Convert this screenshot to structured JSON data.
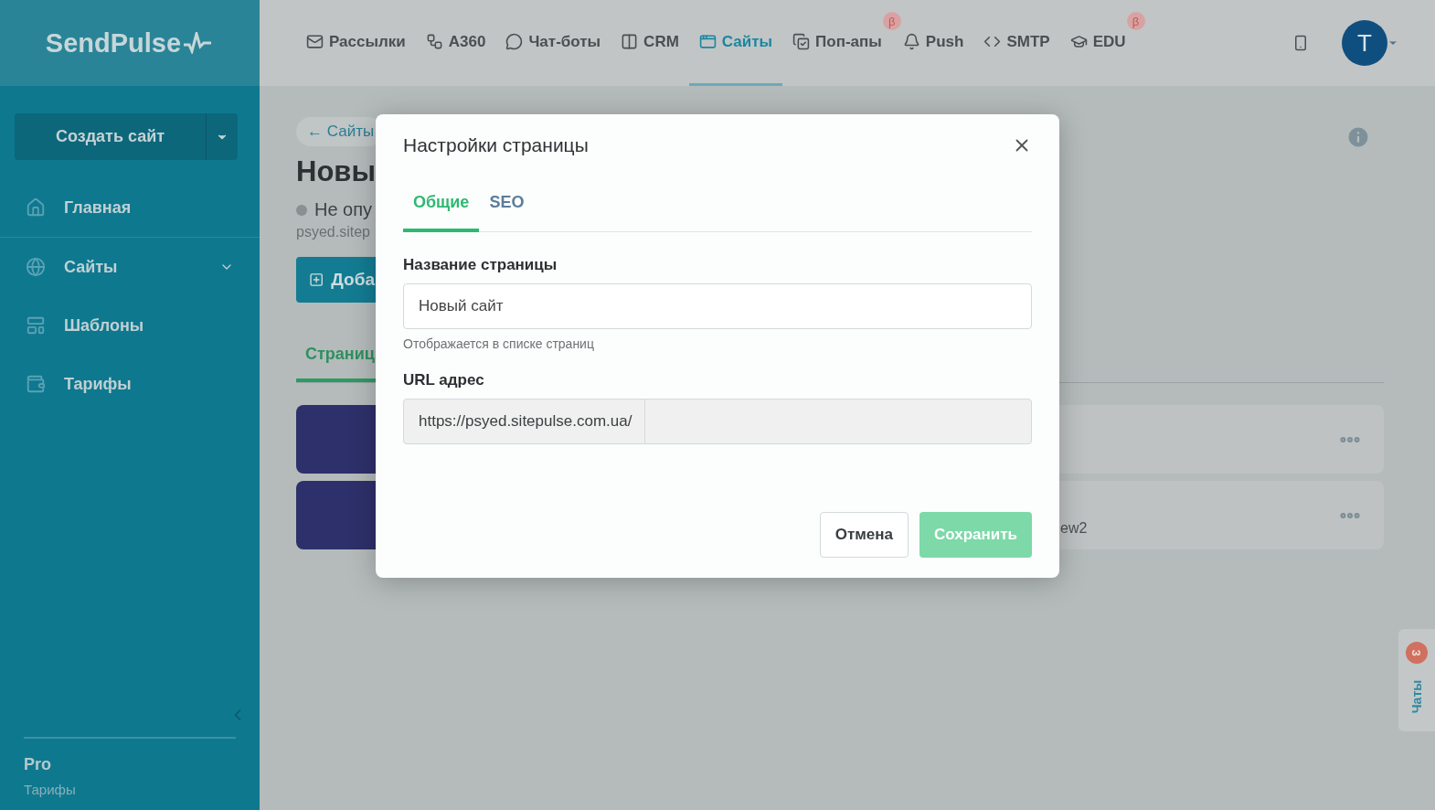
{
  "sidebar": {
    "logo": "SendPulse",
    "create_button": "Создать сайт",
    "items": [
      {
        "label": "Главная",
        "expandable": false
      },
      {
        "label": "Сайты",
        "expandable": true
      },
      {
        "label": "Шаблоны",
        "expandable": false
      },
      {
        "label": "Тарифы",
        "expandable": false
      }
    ],
    "plan": {
      "name": "Pro",
      "link": "Тарифы"
    }
  },
  "topnav": {
    "items": [
      {
        "label": "Рассылки",
        "selected": false
      },
      {
        "label": "A360",
        "selected": false
      },
      {
        "label": "Чат-боты",
        "selected": false
      },
      {
        "label": "CRM",
        "selected": false
      },
      {
        "label": "Сайты",
        "selected": true
      },
      {
        "label": "Поп-апы",
        "selected": false,
        "badge": "β"
      },
      {
        "label": "Push",
        "selected": false
      },
      {
        "label": "SMTP",
        "selected": false
      },
      {
        "label": "EDU",
        "selected": false,
        "badge": "β"
      }
    ],
    "avatar": "T"
  },
  "page": {
    "breadcrumb": "← Сайты",
    "title": "Новы",
    "status": "Не опу",
    "domain": "psyed.sitep",
    "add_button": "Доба",
    "tab": "Страниц",
    "rows": [
      {
        "kind": "page"
      },
      {
        "kind": "page",
        "subtitle": "ew2"
      }
    ]
  },
  "modal": {
    "title": "Настройки страницы",
    "tabs": [
      {
        "label": "Общие",
        "selected": true
      },
      {
        "label": "SEO",
        "selected": false
      }
    ],
    "name_label": "Название страницы",
    "name_value": "Новый сайт",
    "name_hint": "Отображается в списке страниц",
    "url_label": "URL адрес",
    "url_prefix": "https://psyed.sitepulse.com.ua/",
    "cancel": "Отмена",
    "save": {
      "label": "Сохранить",
      "disabled": true
    }
  },
  "chats": {
    "label": "Чаты",
    "count": "3"
  }
}
